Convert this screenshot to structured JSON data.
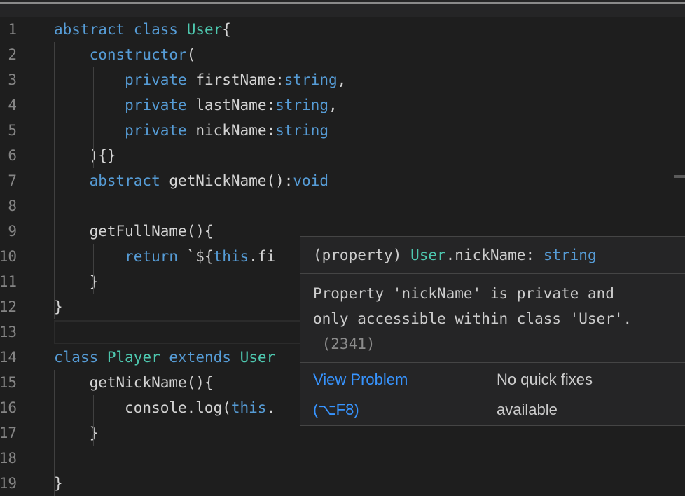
{
  "lines": [
    {
      "num": "1",
      "segments": [
        {
          "t": "abstract",
          "c": "kw"
        },
        {
          "t": " "
        },
        {
          "t": "class",
          "c": "kw"
        },
        {
          "t": " "
        },
        {
          "t": "User",
          "c": "ty"
        },
        {
          "t": "{"
        }
      ]
    },
    {
      "num": "2",
      "segments": [
        {
          "t": "    "
        },
        {
          "t": "constructor",
          "c": "kw"
        },
        {
          "t": "("
        }
      ]
    },
    {
      "num": "3",
      "segments": [
        {
          "t": "        "
        },
        {
          "t": "private",
          "c": "kw"
        },
        {
          "t": " firstName:"
        },
        {
          "t": "string",
          "c": "kw"
        },
        {
          "t": ","
        }
      ]
    },
    {
      "num": "4",
      "segments": [
        {
          "t": "        "
        },
        {
          "t": "private",
          "c": "kw"
        },
        {
          "t": " lastName:"
        },
        {
          "t": "string",
          "c": "kw"
        },
        {
          "t": ","
        }
      ]
    },
    {
      "num": "5",
      "segments": [
        {
          "t": "        "
        },
        {
          "t": "private",
          "c": "kw"
        },
        {
          "t": " nickName:"
        },
        {
          "t": "string",
          "c": "kw"
        }
      ]
    },
    {
      "num": "6",
      "segments": [
        {
          "t": "    "
        },
        {
          "t": "){}"
        }
      ]
    },
    {
      "num": "7",
      "segments": [
        {
          "t": "    "
        },
        {
          "t": "abstract",
          "c": "kw"
        },
        {
          "t": " getNickName():"
        },
        {
          "t": "void",
          "c": "kw"
        }
      ]
    },
    {
      "num": "8",
      "segments": []
    },
    {
      "num": "9",
      "segments": [
        {
          "t": "    getFullName(){"
        }
      ]
    },
    {
      "num": "10",
      "segments": [
        {
          "t": "        "
        },
        {
          "t": "return",
          "c": "kw"
        },
        {
          "t": " `${"
        },
        {
          "t": "this",
          "c": "kw"
        },
        {
          "t": ".fi"
        }
      ]
    },
    {
      "num": "11",
      "segments": [
        {
          "t": "    }"
        }
      ]
    },
    {
      "num": "12",
      "segments": [
        {
          "t": "}"
        }
      ]
    },
    {
      "num": "13",
      "segments": []
    },
    {
      "num": "14",
      "segments": [
        {
          "t": "class",
          "c": "kw"
        },
        {
          "t": " "
        },
        {
          "t": "Player",
          "c": "ty"
        },
        {
          "t": " "
        },
        {
          "t": "extends",
          "c": "kw"
        },
        {
          "t": " "
        },
        {
          "t": "User",
          "c": "ty"
        }
      ]
    },
    {
      "num": "15",
      "segments": [
        {
          "t": "    getNickName(){"
        }
      ]
    },
    {
      "num": "16",
      "segments": [
        {
          "t": "        console.log("
        },
        {
          "t": "this",
          "c": "kw"
        },
        {
          "t": "."
        }
      ]
    },
    {
      "num": "17",
      "segments": [
        {
          "t": "    }"
        }
      ]
    },
    {
      "num": "18",
      "segments": []
    },
    {
      "num": "19",
      "segments": [
        {
          "t": "}"
        }
      ]
    }
  ],
  "hover": {
    "sig_prefix": "(property) ",
    "sig_class": "User",
    "sig_member": ".nickName: ",
    "sig_type": "string",
    "message_line1": "Property 'nickName' is private and",
    "message_line2": "only accessible within class 'User'.",
    "error_code": " (2341)",
    "view_problem": "View Problem",
    "shortcut": "(⌥F8)",
    "no_fixes_1": "No quick fixes",
    "no_fixes_2": "available"
  },
  "colors": {
    "keyword": "#569cd6",
    "type": "#4ec9b0",
    "text": "#d4d4d4",
    "line_number": "#858585",
    "link": "#3794ff"
  }
}
